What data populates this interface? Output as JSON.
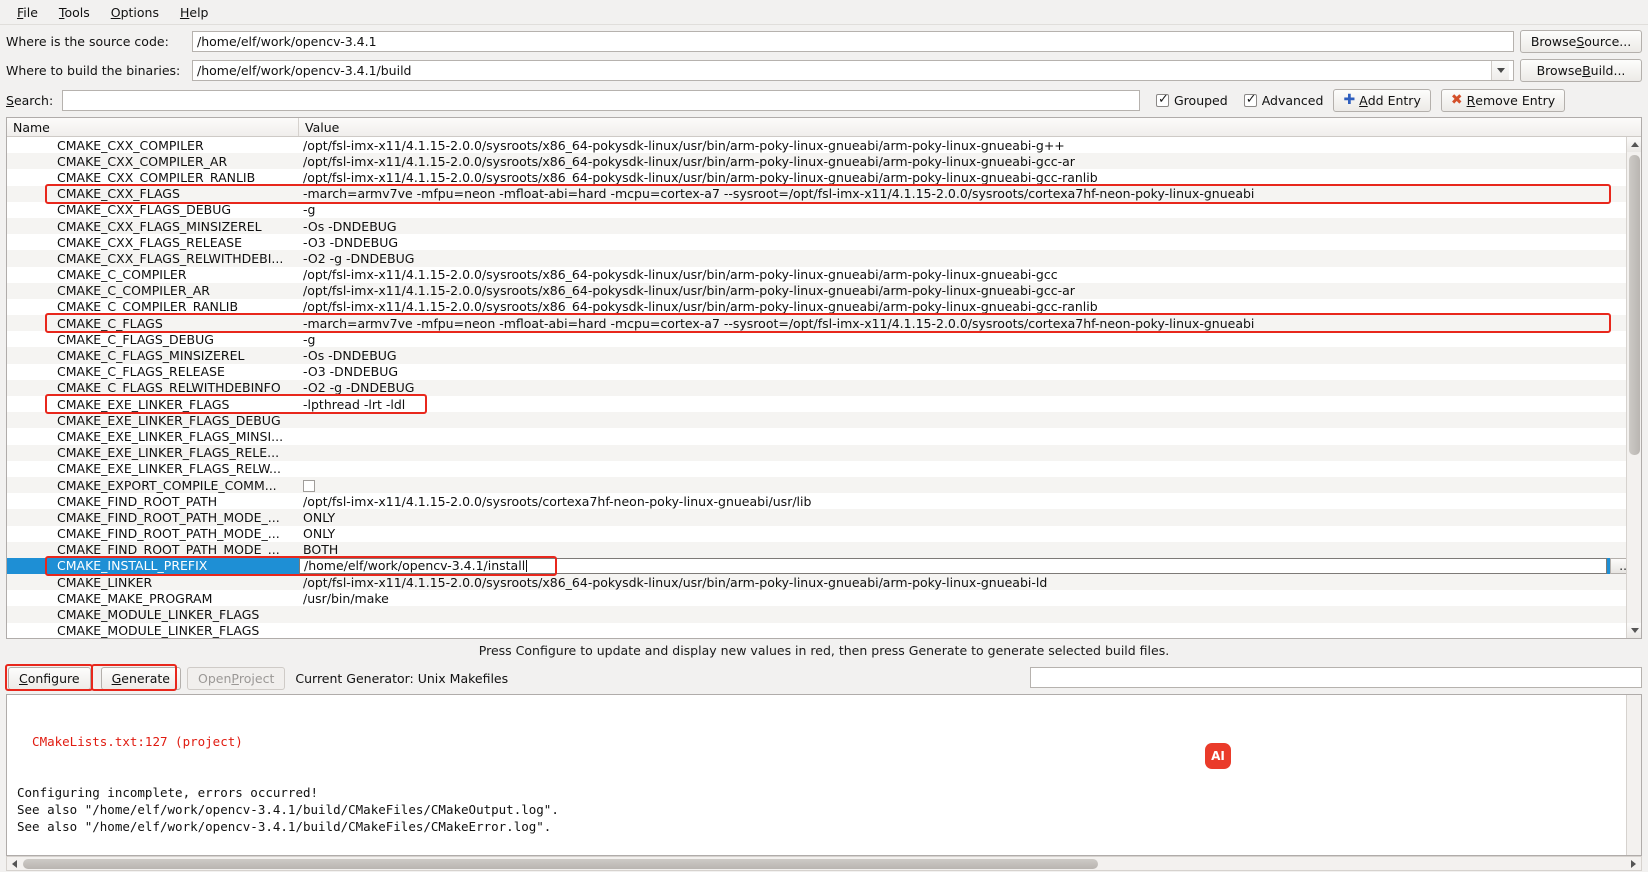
{
  "menu": {
    "items": [
      {
        "label": "File",
        "accel": "F"
      },
      {
        "label": "Tools",
        "accel": "T"
      },
      {
        "label": "Options",
        "accel": "O"
      },
      {
        "label": "Help",
        "accel": "H"
      }
    ]
  },
  "paths": {
    "source_label": "Where is the source code:",
    "source_value": "/home/elf/work/opencv-3.4.1",
    "build_label": "Where to build the binaries:",
    "build_value": "/home/elf/work/opencv-3.4.1/build",
    "browse_source_label": "Browse Source...",
    "browse_build_label": "Browse Build..."
  },
  "search": {
    "label": "Search:",
    "value": "",
    "placeholder": "",
    "grouped_label": "Grouped",
    "grouped_checked": true,
    "advanced_label": "Advanced",
    "advanced_checked": true,
    "add_entry_label": "Add Entry",
    "remove_entry_label": "Remove Entry"
  },
  "table": {
    "col_name": "Name",
    "col_value": "Value",
    "rows": [
      {
        "name": "CMAKE_CXX_COMPILER",
        "value": "/opt/fsl-imx-x11/4.1.15-2.0.0/sysroots/x86_64-pokysdk-linux/usr/bin/arm-poky-linux-gnueabi/arm-poky-linux-gnueabi-g++"
      },
      {
        "name": "CMAKE_CXX_COMPILER_AR",
        "value": "/opt/fsl-imx-x11/4.1.15-2.0.0/sysroots/x86_64-pokysdk-linux/usr/bin/arm-poky-linux-gnueabi/arm-poky-linux-gnueabi-gcc-ar"
      },
      {
        "name": "CMAKE_CXX_COMPILER_RANLIB",
        "value": "/opt/fsl-imx-x11/4.1.15-2.0.0/sysroots/x86_64-pokysdk-linux/usr/bin/arm-poky-linux-gnueabi/arm-poky-linux-gnueabi-gcc-ranlib"
      },
      {
        "name": "CMAKE_CXX_FLAGS",
        "value": "-march=armv7ve -mfpu=neon  -mfloat-abi=hard -mcpu=cortex-a7 --sysroot=/opt/fsl-imx-x11/4.1.15-2.0.0/sysroots/cortexa7hf-neon-poky-linux-gnueabi",
        "highlight": true
      },
      {
        "name": "CMAKE_CXX_FLAGS_DEBUG",
        "value": "-g"
      },
      {
        "name": "CMAKE_CXX_FLAGS_MINSIZEREL",
        "value": "-Os -DNDEBUG"
      },
      {
        "name": "CMAKE_CXX_FLAGS_RELEASE",
        "value": "-O3 -DNDEBUG"
      },
      {
        "name": "CMAKE_CXX_FLAGS_RELWITHDEBI...",
        "value": "-O2 -g -DNDEBUG"
      },
      {
        "name": "CMAKE_C_COMPILER",
        "value": "/opt/fsl-imx-x11/4.1.15-2.0.0/sysroots/x86_64-pokysdk-linux/usr/bin/arm-poky-linux-gnueabi/arm-poky-linux-gnueabi-gcc"
      },
      {
        "name": "CMAKE_C_COMPILER_AR",
        "value": "/opt/fsl-imx-x11/4.1.15-2.0.0/sysroots/x86_64-pokysdk-linux/usr/bin/arm-poky-linux-gnueabi/arm-poky-linux-gnueabi-gcc-ar"
      },
      {
        "name": "CMAKE_C_COMPILER_RANLIB",
        "value": "/opt/fsl-imx-x11/4.1.15-2.0.0/sysroots/x86_64-pokysdk-linux/usr/bin/arm-poky-linux-gnueabi/arm-poky-linux-gnueabi-gcc-ranlib"
      },
      {
        "name": "CMAKE_C_FLAGS",
        "value": "-march=armv7ve -mfpu=neon  -mfloat-abi=hard -mcpu=cortex-a7 --sysroot=/opt/fsl-imx-x11/4.1.15-2.0.0/sysroots/cortexa7hf-neon-poky-linux-gnueabi",
        "highlight": true
      },
      {
        "name": "CMAKE_C_FLAGS_DEBUG",
        "value": "-g"
      },
      {
        "name": "CMAKE_C_FLAGS_MINSIZEREL",
        "value": "-Os -DNDEBUG"
      },
      {
        "name": "CMAKE_C_FLAGS_RELEASE",
        "value": "-O3 -DNDEBUG"
      },
      {
        "name": "CMAKE_C_FLAGS_RELWITHDEBINFO",
        "value": "-O2 -g -DNDEBUG"
      },
      {
        "name": "CMAKE_EXE_LINKER_FLAGS",
        "value": "-lpthread -lrt -ldl",
        "highlight": true
      },
      {
        "name": "CMAKE_EXE_LINKER_FLAGS_DEBUG",
        "value": ""
      },
      {
        "name": "CMAKE_EXE_LINKER_FLAGS_MINSI...",
        "value": ""
      },
      {
        "name": "CMAKE_EXE_LINKER_FLAGS_RELE...",
        "value": ""
      },
      {
        "name": "CMAKE_EXE_LINKER_FLAGS_RELW...",
        "value": ""
      },
      {
        "name": "CMAKE_EXPORT_COMPILE_COMM...",
        "value": "",
        "checkbox": true
      },
      {
        "name": "CMAKE_FIND_ROOT_PATH",
        "value": "/opt/fsl-imx-x11/4.1.15-2.0.0/sysroots/cortexa7hf-neon-poky-linux-gnueabi/usr/lib"
      },
      {
        "name": "CMAKE_FIND_ROOT_PATH_MODE_...",
        "value": "ONLY"
      },
      {
        "name": "CMAKE_FIND_ROOT_PATH_MODE_...",
        "value": "ONLY"
      },
      {
        "name": "CMAKE_FIND_ROOT_PATH_MODE_...",
        "value": "BOTH"
      },
      {
        "name": "CMAKE_INSTALL_PREFIX",
        "value": "/home/elf/work/opencv-3.4.1/install",
        "selected": true,
        "editing": true,
        "highlight": true,
        "ellipsis": "..."
      },
      {
        "name": "CMAKE_LINKER",
        "value": "/opt/fsl-imx-x11/4.1.15-2.0.0/sysroots/x86_64-pokysdk-linux/usr/bin/arm-poky-linux-gnueabi/arm-poky-linux-gnueabi-ld"
      },
      {
        "name": "CMAKE_MAKE_PROGRAM",
        "value": "/usr/bin/make"
      },
      {
        "name": "CMAKE_MODULE_LINKER_FLAGS",
        "value": ""
      },
      {
        "name": "CMAKE_MODULE_LINKER_FLAGS",
        "value": ""
      }
    ]
  },
  "status": {
    "hint": "Press Configure to update and display new values in red, then press Generate to generate selected build files."
  },
  "actions": {
    "configure_label": "Configure",
    "configure_accel": "C",
    "generate_label": "Generate",
    "generate_accel": "G",
    "open_project_label": "Open Project",
    "open_project_disabled": true,
    "generator_label": "Current Generator: Unix Makefiles",
    "generator_field_value": ""
  },
  "console": {
    "lines": [
      {
        "text": "  CMakeLists.txt:127 (project)",
        "color": "error"
      },
      {
        "text": "",
        "color": "normal"
      },
      {
        "text": "",
        "color": "normal"
      },
      {
        "text": "Configuring incomplete, errors occurred!",
        "color": "normal"
      },
      {
        "text": "See also \"/home/elf/work/opencv-3.4.1/build/CMakeFiles/CMakeOutput.log\".",
        "color": "normal"
      },
      {
        "text": "See also \"/home/elf/work/opencv-3.4.1/build/CMakeFiles/CMakeError.log\".",
        "color": "normal"
      }
    ]
  },
  "badge": {
    "label": "AI",
    "color": "#ea3b2a"
  },
  "colors": {
    "highlight_red": "#e8271c",
    "selection_blue": "#1e8fd5",
    "error_red": "#e01b10",
    "window_bg": "#f2f1f0"
  }
}
